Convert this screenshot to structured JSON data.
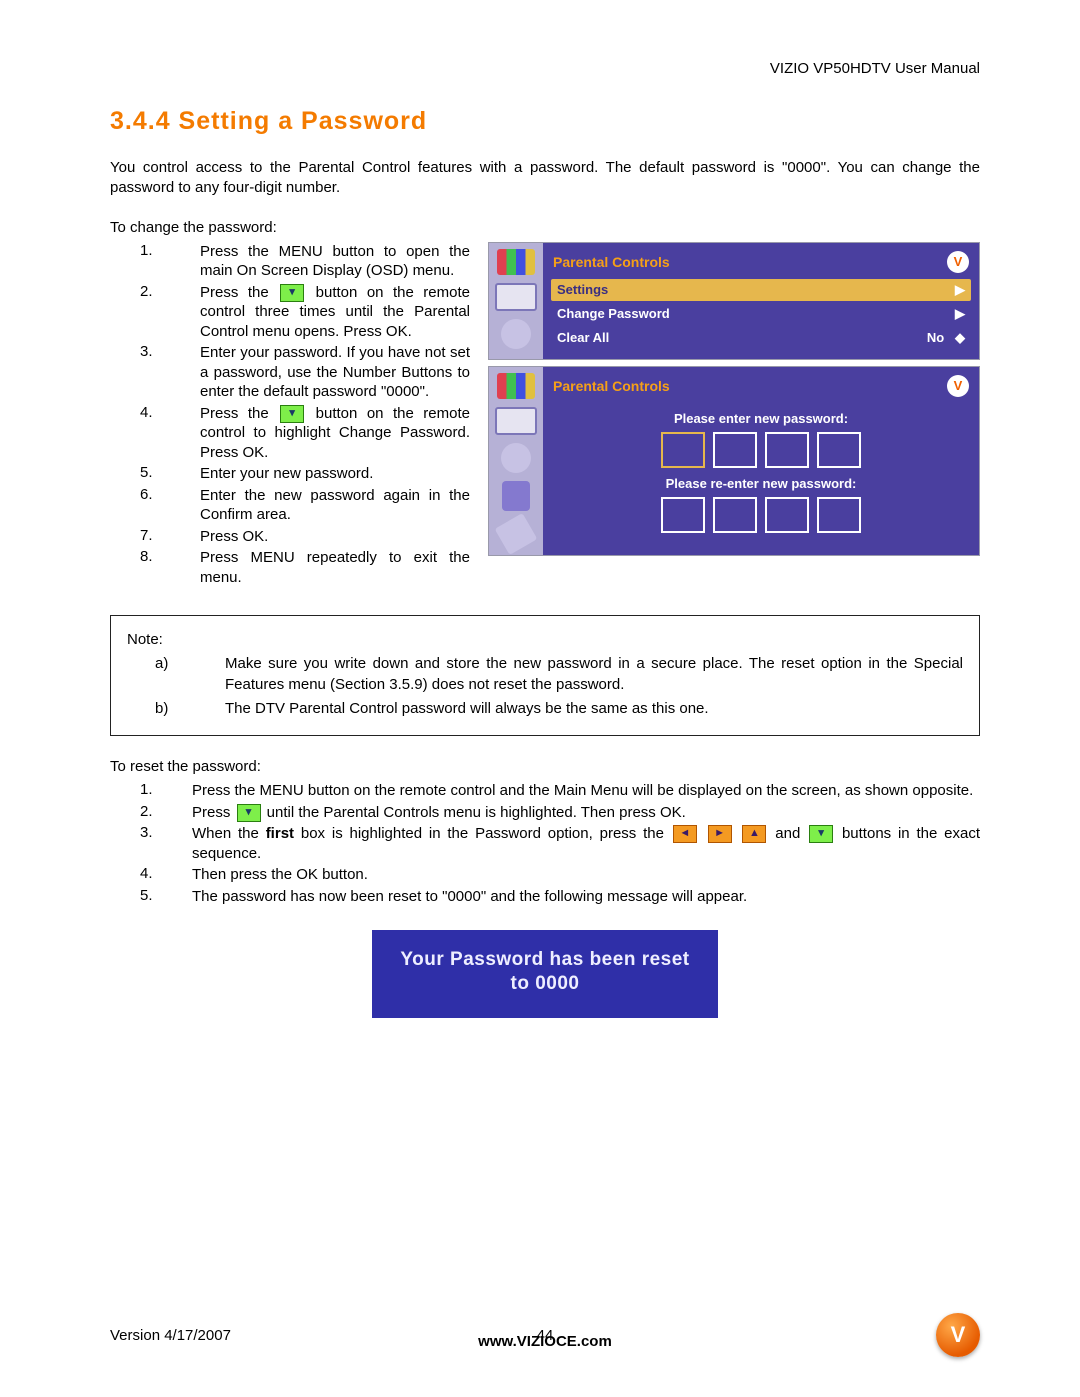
{
  "header": {
    "right": "VIZIO VP50HDTV User Manual"
  },
  "heading": "3.4.4 Setting a Password",
  "intro": "You control access to the Parental Control features with a password.  The default password is \"0000\". You can change the password to any four-digit number.",
  "change_label": "To change the password:",
  "steps": [
    "Press the MENU button to open the main On Screen Display (OSD) menu.",
    "",
    "Enter your password. If you have not set a password, use the Number Buttons to enter the default password \"0000\".",
    "",
    "Enter your new password.",
    "Enter the new password again in the Confirm area.",
    "Press OK.",
    "Press MENU repeatedly to exit the menu."
  ],
  "step2_pre": "Press the ",
  "step2_post": " button on the remote control three times until the Parental Control menu opens.  Press OK.",
  "step4_pre": "Press the ",
  "step4_post": " button on the remote control to highlight Change Password.  Press OK.",
  "osd1": {
    "title": "Parental Controls",
    "rows": [
      {
        "label": "Settings",
        "value": "▶",
        "hl": true
      },
      {
        "label": "Change Password",
        "value": "▶",
        "hl": false
      },
      {
        "label": "Clear All",
        "value": "No",
        "hl": false
      }
    ]
  },
  "osd2": {
    "title": "Parental Controls",
    "prompt1": "Please enter new password:",
    "prompt2": "Please re-enter new password:"
  },
  "note": {
    "title": "Note:",
    "items": [
      "Make sure you write down and store the new password in a secure place.  The reset option in the Special Features menu (Section 3.5.9) does not reset the password.",
      "The DTV Parental Control password will always be the same as this one."
    ]
  },
  "reset_label": "To reset the password:",
  "reset_steps": {
    "s1": "Press the MENU button on the remote control and the Main Menu will be displayed on the screen, as shown opposite.",
    "s2_pre": "Press ",
    "s2_post": " until the Parental Controls menu is highlighted.  Then press OK.",
    "s3_pre": "When the ",
    "s3_bold": "first",
    "s3_mid": " box is highlighted in the Password option, press the ",
    "s3_and": " and ",
    "s3_post": " buttons in the exact sequence.",
    "s4": "Then press the OK button.",
    "s5": "The password has now been reset to \"0000\" and the following message will appear."
  },
  "banner": "Your Password has been reset to 0000",
  "footer": {
    "version": "Version 4/17/2007",
    "page": "44",
    "url": "www.VIZIOCE.com",
    "logo": "V"
  },
  "icons": {
    "down": "▾",
    "left": "◄",
    "right": "►",
    "up": "▲"
  }
}
